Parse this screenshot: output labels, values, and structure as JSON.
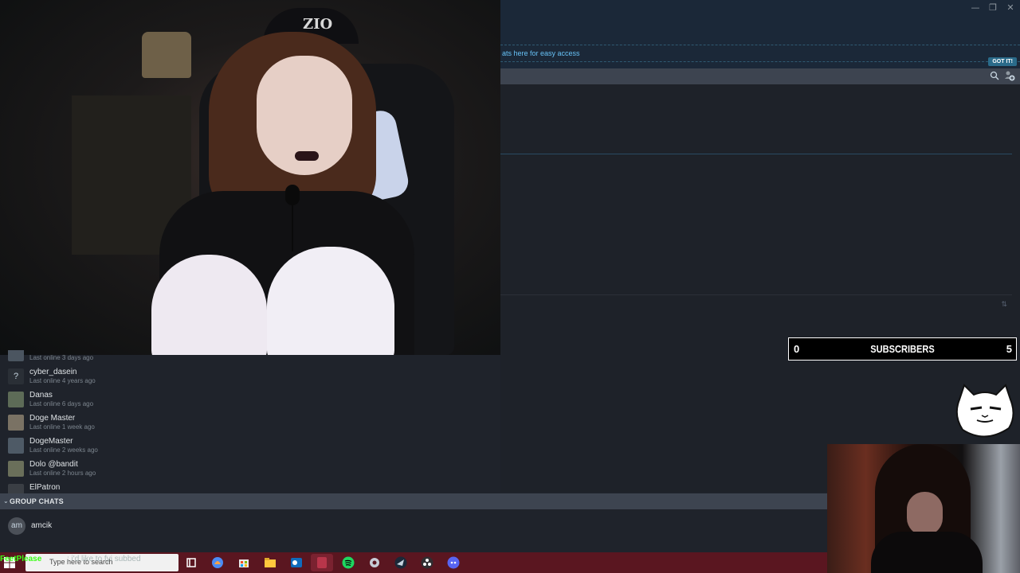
{
  "window": {
    "controls": {
      "minimize": "—",
      "restore": "❐",
      "close": "✕"
    },
    "tip_text": "ats here for easy access",
    "got_it_label": "GOT IT!",
    "sort_symbol": "⇅"
  },
  "webcam_main": {
    "cap_logo": "ZIO"
  },
  "friends": [
    {
      "name": "",
      "status": "Last online 3 days ago",
      "avatar": ""
    },
    {
      "name": "cyber_dasein",
      "status": "Last online 4 years ago",
      "avatar": "?"
    },
    {
      "name": "Danas",
      "status": "Last online 6 days ago",
      "avatar": ""
    },
    {
      "name": "Doge Master",
      "status": "Last online 1 week ago",
      "avatar": ""
    },
    {
      "name": "DogeMaster",
      "status": "Last online 2 weeks ago",
      "avatar": ""
    },
    {
      "name": "Dolo @bandit",
      "status": "Last online 2 hours ago",
      "avatar": ""
    },
    {
      "name": "ElPatron",
      "status": "",
      "avatar": ""
    }
  ],
  "group_chats": {
    "title": "GROUP CHATS",
    "caret": "⌄",
    "items": [
      {
        "avatar": "am",
        "name": "amcik"
      }
    ]
  },
  "subscribers": {
    "left_count": "0",
    "label": "SUBSCRIBERS",
    "right_count": "5"
  },
  "taskbar": {
    "search_placeholder": "Type here to search",
    "overlay_name": "FeetPlease",
    "overlay_message": ": i'd like to fyi subbed",
    "icons": [
      "task-view-icon",
      "copilot-icon",
      "store-icon",
      "file-explorer-icon",
      "outlook-icon",
      "app-icon",
      "spotify-icon",
      "settings-icon",
      "steam-icon",
      "obs-icon",
      "discord-icon"
    ],
    "colors": {
      "bar": "#5a1620",
      "accent": "#39ff14"
    }
  }
}
